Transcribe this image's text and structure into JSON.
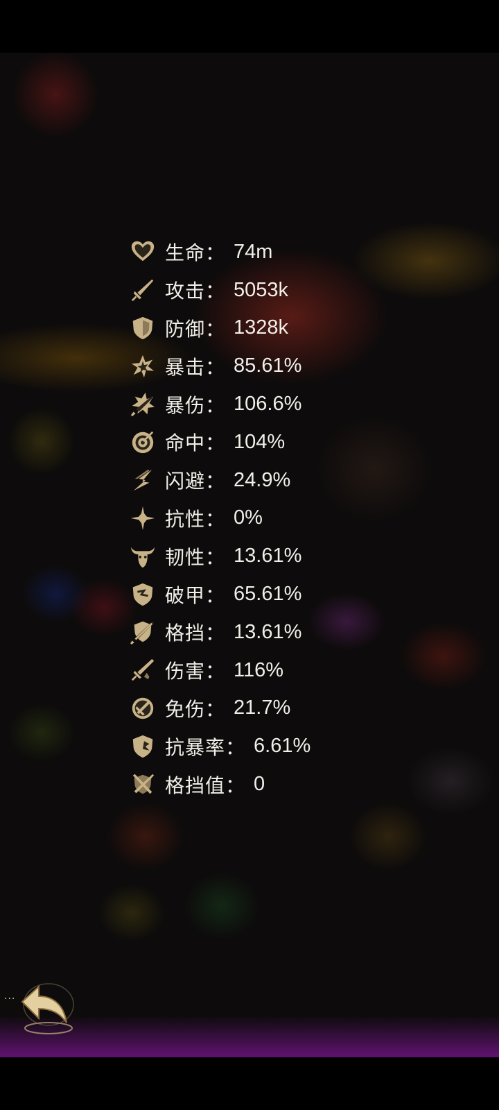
{
  "colors": {
    "icon_gold": "#c8b287",
    "text": "#f2efe9",
    "background": "#0d0b0b",
    "bottom_glow": "#6e1482"
  },
  "stats": [
    {
      "icon": "heart-icon",
      "label": "生命：",
      "value": "74m"
    },
    {
      "icon": "sword-icon",
      "label": "攻击：",
      "value": "5053k"
    },
    {
      "icon": "shield-icon",
      "label": "防御：",
      "value": "1328k"
    },
    {
      "icon": "crit-burst-icon",
      "label": "暴击：",
      "value": "85.61%"
    },
    {
      "icon": "crit-damage-icon",
      "label": "暴伤：",
      "value": "106.6%"
    },
    {
      "icon": "target-icon",
      "label": "命中：",
      "value": "104%"
    },
    {
      "icon": "lightning-icon",
      "label": "闪避：",
      "value": "24.9%"
    },
    {
      "icon": "star-sparkle-icon",
      "label": "抗性：",
      "value": "0%"
    },
    {
      "icon": "bull-horns-icon",
      "label": "韧性：",
      "value": "13.61%"
    },
    {
      "icon": "broken-shield-icon",
      "label": "破甲：",
      "value": "65.61%"
    },
    {
      "icon": "block-icon",
      "label": "格挡：",
      "value": "13.61%"
    },
    {
      "icon": "damage-sword-icon",
      "label": "伤害：",
      "value": "116%"
    },
    {
      "icon": "damage-immune-icon",
      "label": "免伤：",
      "value": "21.7%"
    },
    {
      "icon": "anti-crit-shield-icon",
      "label": "抗暴率：",
      "value": "6.61%"
    },
    {
      "icon": "block-value-icon",
      "label": "格挡值：",
      "value": "0"
    }
  ],
  "back_button": {
    "icon": "back-arrow-icon",
    "dots": "···"
  }
}
